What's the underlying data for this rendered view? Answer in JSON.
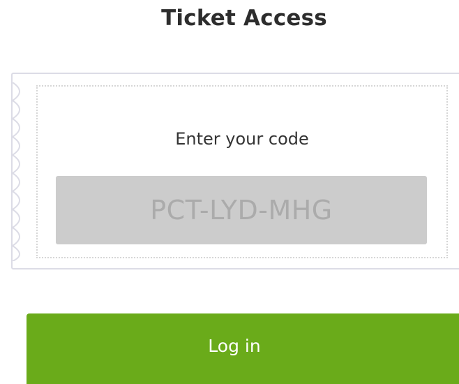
{
  "header": {
    "title": "Ticket Access"
  },
  "ticket": {
    "label": "Enter your code",
    "code_value": "PCT-LYD-MHG"
  },
  "actions": {
    "login_label": "Log in"
  },
  "colors": {
    "button_bg": "#6aab1a",
    "input_bg": "#cccccc",
    "ticket_border": "#dcdce6"
  }
}
